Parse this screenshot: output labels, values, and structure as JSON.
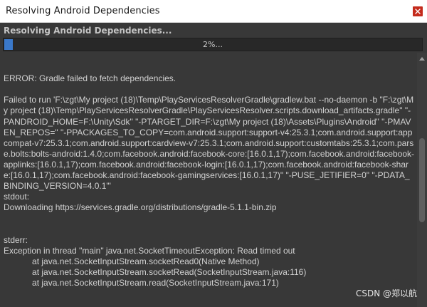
{
  "window": {
    "title": "Resolving Android Dependencies"
  },
  "header": {
    "heading": "Resolving Android Dependencies..."
  },
  "progress": {
    "percent": 2,
    "label": "2%..."
  },
  "log": {
    "text": "\n\nERROR: Gradle failed to fetch dependencies.\n\nFailed to run 'F:\\zgt\\My project (18)\\Temp\\PlayServicesResolverGradle\\gradlew.bat --no-daemon -b \"F:\\zgt\\My project (18)\\Temp\\PlayServicesResolverGradle\\PlayServicesResolver.scripts.download_artifacts.gradle\" \"-PANDROID_HOME=F:\\Unity\\Sdk\" \"-PTARGET_DIR=F:\\zgt\\My project (18)\\Assets\\Plugins\\Android\" \"-PMAVEN_REPOS=\" \"-PPACKAGES_TO_COPY=com.android.support:support-v4:25.3.1;com.android.support:appcompat-v7:25.3.1;com.android.support:cardview-v7:25.3.1;com.android.support:customtabs:25.3.1;com.parse.bolts:bolts-android:1.4.0;com.facebook.android:facebook-core:[16.0.1,17);com.facebook.android:facebook-applinks:[16.0.1,17);com.facebook.android:facebook-login:[16.0.1,17);com.facebook.android:facebook-share:[16.0.1,17);com.facebook.android:facebook-gamingservices:[16.0.1,17)\" \"-PUSE_JETIFIER=0\" \"-PDATA_BINDING_VERSION=4.0.1\"'\nstdout:\nDownloading https://services.gradle.org/distributions/gradle-5.1.1-bin.zip\n\n\nstderr:\nException in thread \"main\" java.net.SocketTimeoutException: Read timed out\n            at java.net.SocketInputStream.socketRead0(Native Method)\n            at java.net.SocketInputStream.socketRead(SocketInputStream.java:116)\n            at java.net.SocketInputStream.read(SocketInputStream.java:171)"
  },
  "watermark": {
    "text": "CSDN @郑以航"
  },
  "colors": {
    "close_button": "#c42b1c",
    "progress_fill": "#3a78c9",
    "background": "#383838"
  }
}
